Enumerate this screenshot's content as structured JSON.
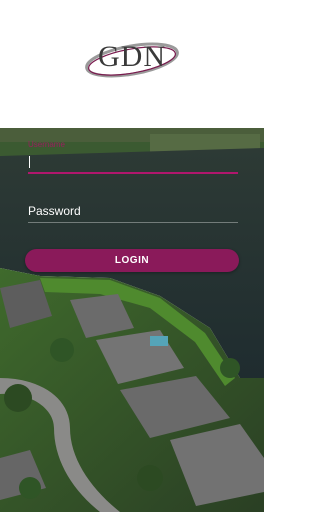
{
  "logo": {
    "text": "GDN"
  },
  "form": {
    "username": {
      "label": "Username",
      "value": ""
    },
    "password": {
      "placeholder": "Password",
      "value": ""
    },
    "login_label": "LOGIN"
  },
  "colors": {
    "accent": "#b0176d",
    "button": "#8a1a5a",
    "header_bg": "#ffffff"
  }
}
